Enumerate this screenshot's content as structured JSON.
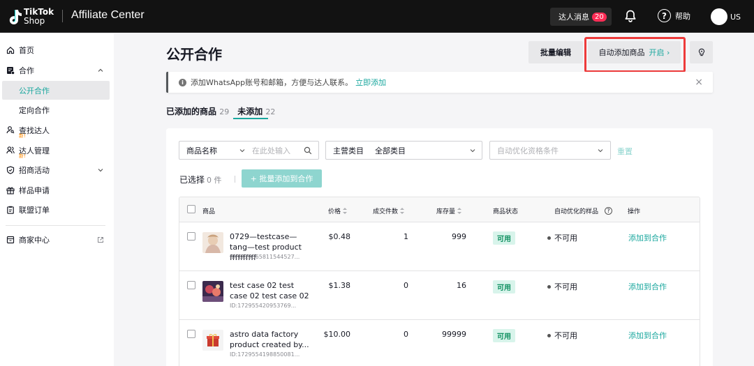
{
  "header": {
    "logo_line1": "TikTok",
    "logo_line2": "Shop",
    "app_title": "Affiliate Center",
    "messages_label": "达人消息",
    "messages_count": "20",
    "help_label": "帮助",
    "user_region": "US"
  },
  "sidebar": {
    "items": [
      {
        "label": "首页",
        "icon": "home-icon"
      },
      {
        "label": "合作",
        "icon": "collab-icon"
      },
      {
        "label": "公开合作"
      },
      {
        "label": "定向合作"
      },
      {
        "label": "查找达人",
        "icon": "find-creator-icon",
        "badge": "新!"
      },
      {
        "label": "达人管理",
        "icon": "creator-manage-icon",
        "badge": "新!"
      },
      {
        "label": "招商活动",
        "icon": "shield-icon"
      },
      {
        "label": "样品申请",
        "icon": "gift-icon"
      },
      {
        "label": "联盟订单",
        "icon": "clipboard-icon"
      },
      {
        "label": "商家中心",
        "icon": "store-icon"
      }
    ]
  },
  "page": {
    "title": "公开合作",
    "bulk_edit": "批量编辑",
    "auto_add_label": "自动添加商品",
    "auto_add_state": "开启 ›",
    "notice_text": "添加WhatsApp账号和邮箱，方便与达人联系。",
    "notice_link": "立即添加",
    "tabs": [
      {
        "label": "已添加的商品",
        "count": "29"
      },
      {
        "label": "未添加",
        "count": "22"
      }
    ]
  },
  "filters": {
    "product_name_key": "商品名称",
    "search_placeholder": "在此处输入",
    "category_key": "主营类目",
    "category_value": "全部类目",
    "auto_opt_placeholder": "自动优化资格条件",
    "reset": "重置"
  },
  "selection": {
    "label": "已选择",
    "count": "0 件",
    "bulk_add": "+ 批量添加到合作"
  },
  "table": {
    "headers": {
      "product": "商品",
      "price": "价格",
      "sold": "成交件数",
      "stock": "库存量",
      "status": "商品状态",
      "auto_sample": "自动优化的样品",
      "action": "操作"
    },
    "rows": [
      {
        "name": "0729—testcase—tang—test product ffffffffff",
        "id": "ID:1729565811544527...",
        "price": "$0.48",
        "sold": "1",
        "stock": "999",
        "status": "可用",
        "auto": "不可用",
        "action": "添加到合作"
      },
      {
        "name": "test case 02 test case 02 test case 02",
        "id": "ID:1729554209537​69...",
        "price": "$1.38",
        "sold": "0",
        "stock": "16",
        "status": "可用",
        "auto": "不可用",
        "action": "添加到合作"
      },
      {
        "name": "astro data factory product created by...",
        "id": "ID:172955419885008​1...",
        "price": "$10.00",
        "sold": "0",
        "stock": "99999",
        "status": "可用",
        "auto": "不可用",
        "action": "添加到合作"
      }
    ]
  },
  "colors": {
    "accent": "#1aa79e",
    "badge": "#fe2c55",
    "highlight": "#ee3b3b"
  }
}
